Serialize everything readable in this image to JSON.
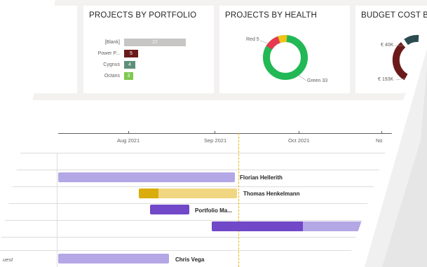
{
  "cards": {
    "portfolio": {
      "title": "PROJECTS BY PORTFOLIO",
      "bars": [
        {
          "label": "[Blank]",
          "value": "22",
          "fraction": 1.0,
          "color": "#c8c6c4"
        },
        {
          "label": "Power P...",
          "value": "5",
          "fraction": 0.23,
          "color": "#6b1a1a"
        },
        {
          "label": "Cygnus",
          "value": "4",
          "fraction": 0.18,
          "color": "#5f8f7a"
        },
        {
          "label": "Octans",
          "value": "3",
          "fraction": 0.14,
          "color": "#7ec850"
        }
      ]
    },
    "health": {
      "title": "PROJECTS BY HEALTH",
      "red_label": "Red 5",
      "green_label": "Green 33",
      "segments": [
        {
          "name": "Green",
          "value": 33,
          "color": "#22b855"
        },
        {
          "name": "Red",
          "value": 5,
          "color": "#e8384f"
        },
        {
          "name": "Yellow",
          "value": 2,
          "color": "#f0c419"
        }
      ]
    },
    "budget": {
      "title": "BUDGET COST BY P",
      "label_top": "€ 40K",
      "label_bottom": "€ 193K"
    }
  },
  "timeline": {
    "months": [
      "Aug 2021",
      "Sep 2021",
      "Oct 2021",
      "No"
    ]
  },
  "gantt": {
    "rows": [
      {
        "name": "Florian Hellerith"
      },
      {
        "name": "Thomas Henkelmann"
      },
      {
        "name": "Portfolio Ma..."
      },
      {
        "name": ""
      },
      {
        "name": "Chris Vega",
        "left_text": "uest"
      }
    ]
  },
  "colors": {
    "lavender": "#b4a7e5",
    "purple": "#7048c8",
    "gold": "#d9ad0b",
    "gold_light": "#f0d680",
    "today_line": "#e8b800"
  }
}
